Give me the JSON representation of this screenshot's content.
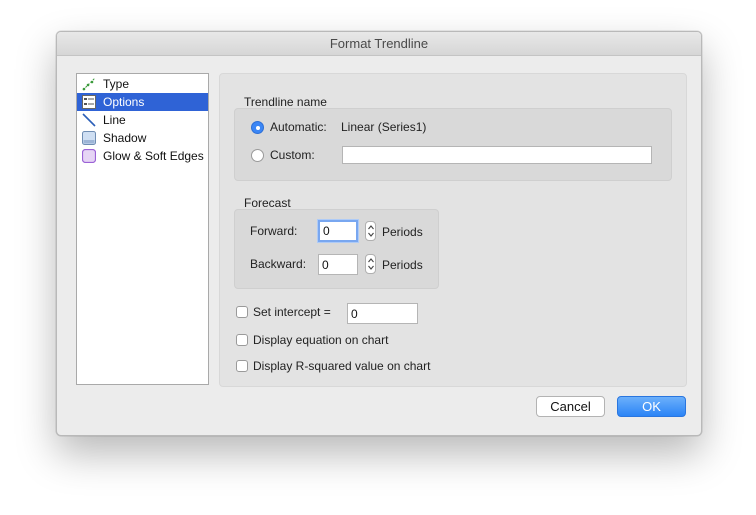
{
  "window": {
    "title": "Format Trendline"
  },
  "sidebar": {
    "items": [
      {
        "label": "Type",
        "icon": "trendline-type-icon",
        "selected": false
      },
      {
        "label": "Options",
        "icon": "options-icon",
        "selected": true
      },
      {
        "label": "Line",
        "icon": "line-icon",
        "selected": false
      },
      {
        "label": "Shadow",
        "icon": "shadow-icon",
        "selected": false
      },
      {
        "label": "Glow & Soft Edges",
        "icon": "glow-icon",
        "selected": false
      }
    ]
  },
  "trendline_name": {
    "heading": "Trendline name",
    "automatic_label": "Automatic:",
    "automatic_value": "Linear (Series1)",
    "automatic_selected": true,
    "custom_label": "Custom:",
    "custom_value": ""
  },
  "forecast": {
    "heading": "Forecast",
    "forward_label": "Forward:",
    "forward_value": "0",
    "forward_unit": "Periods",
    "backward_label": "Backward:",
    "backward_value": "0",
    "backward_unit": "Periods"
  },
  "options": {
    "set_intercept_label": "Set intercept =",
    "set_intercept_checked": false,
    "intercept_value": "0",
    "display_equation_label": "Display equation on chart",
    "display_equation_checked": false,
    "display_r_squared_label": "Display R-squared value on chart",
    "display_r_squared_checked": false
  },
  "buttons": {
    "cancel": "Cancel",
    "ok": "OK"
  },
  "colors": {
    "selection": "#2f63d6",
    "accent": "#2b84f6"
  }
}
